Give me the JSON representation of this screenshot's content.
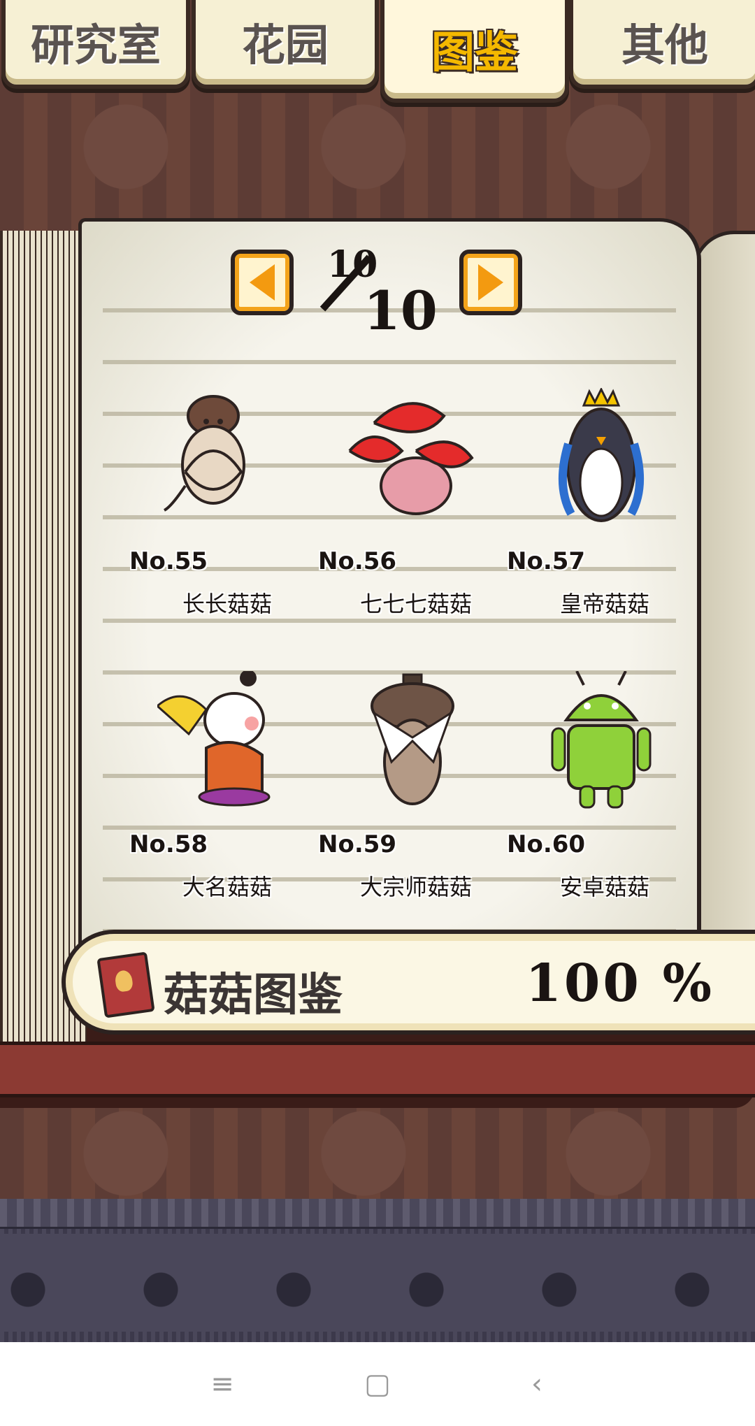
{
  "tabs": [
    {
      "label": "研究室",
      "active": false
    },
    {
      "label": "花园",
      "active": false
    },
    {
      "label": "图鉴",
      "active": true
    },
    {
      "label": "其他",
      "active": false
    }
  ],
  "pager": {
    "current": "10",
    "total": "10"
  },
  "entries": [
    {
      "number": "No.55",
      "name": "长长菇菇",
      "icon": "long-mushroom-icon"
    },
    {
      "number": "No.56",
      "name": "七七七菇菇",
      "icon": "red-triple-mushroom-icon"
    },
    {
      "number": "No.57",
      "name": "皇帝菇菇",
      "icon": "emperor-penguin-mushroom-icon"
    },
    {
      "number": "No.58",
      "name": "大名菇菇",
      "icon": "daimyo-mushroom-icon"
    },
    {
      "number": "No.59",
      "name": "大宗师菇菇",
      "icon": "grandmaster-mushroom-icon"
    },
    {
      "number": "No.60",
      "name": "安卓菇菇",
      "icon": "android-mushroom-icon"
    }
  ],
  "summary": {
    "label": "菇菇图鉴",
    "percent": "100",
    "percent_sign": "%"
  },
  "system_nav": {
    "menu": "≡",
    "home": "▢",
    "back": "‹"
  },
  "colors": {
    "accent": "#f3a31a",
    "active_tab_text": "#f4b800",
    "page": "#f6f4ec",
    "frame": "#2c2220"
  }
}
